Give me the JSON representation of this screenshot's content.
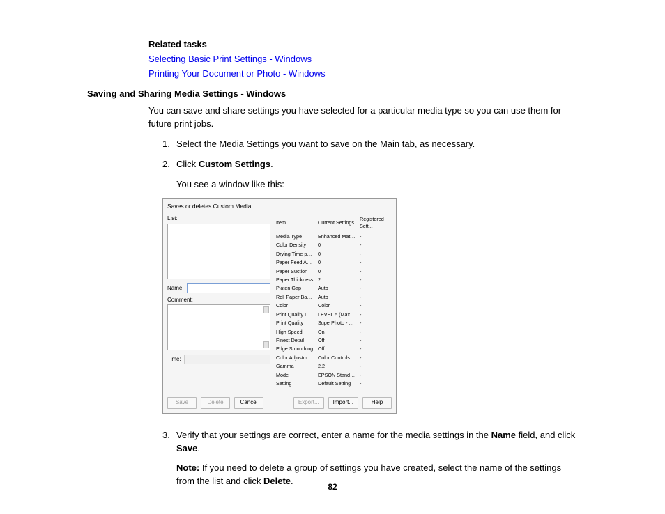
{
  "related": {
    "heading": "Related tasks",
    "links": [
      "Selecting Basic Print Settings - Windows",
      "Printing Your Document or Photo - Windows"
    ]
  },
  "section_heading": "Saving and Sharing Media Settings - Windows",
  "intro": "You can save and share settings you have selected for a particular media type so you can use them for future print jobs.",
  "steps": {
    "s1": "Select the Media Settings you want to save on the Main tab, as necessary.",
    "s2_pre": "Click ",
    "s2_bold": "Custom Settings",
    "s2_post": ".",
    "s2_line2": "You see a window like this:",
    "s3_pre": "Verify that your settings are correct, enter a name for the media settings in the ",
    "s3_bold1": "Name",
    "s3_mid": " field, and click ",
    "s3_bold2": "Save",
    "s3_post": "."
  },
  "note": {
    "label": "Note:",
    "text": " If you need to delete a group of settings you have created, select the name of the settings from the list and click ",
    "bold": "Delete",
    "post": "."
  },
  "dialog": {
    "title": "Saves or deletes Custom Media",
    "list_lbl": "List:",
    "name_lbl": "Name:",
    "comment_lbl": "Comment:",
    "time_lbl": "Time:",
    "headers": {
      "item": "Item",
      "cur": "Current Settings",
      "reg": "Registered Sett..."
    },
    "rows": [
      {
        "item": "Media Type",
        "cur": "Enhanced Matt...",
        "reg": "-"
      },
      {
        "item": "Color Density",
        "cur": "0",
        "reg": "-"
      },
      {
        "item": "Drying Time per ...",
        "cur": "0",
        "reg": "-"
      },
      {
        "item": "Paper Feed Adju...",
        "cur": "0",
        "reg": "-"
      },
      {
        "item": "Paper Suction",
        "cur": "0",
        "reg": "-"
      },
      {
        "item": "Paper Thickness",
        "cur": "2",
        "reg": "-"
      },
      {
        "item": "Platen Gap",
        "cur": "Auto",
        "reg": "-"
      },
      {
        "item": "Roll Paper Back ...",
        "cur": "Auto",
        "reg": "-"
      },
      {
        "item": "Color",
        "cur": "Color",
        "reg": "-"
      },
      {
        "item": "Print Quality Level",
        "cur": "LEVEL 5 (Max Q...",
        "reg": "-"
      },
      {
        "item": "Print Quality",
        "cur": "SuperPhoto - 2...",
        "reg": "-"
      },
      {
        "item": "High Speed",
        "cur": "On",
        "reg": "-"
      },
      {
        "item": "Finest Detail",
        "cur": "Off",
        "reg": "-"
      },
      {
        "item": "Edge Smoothing",
        "cur": "Off",
        "reg": "-"
      },
      {
        "item": "Color Adjustment",
        "cur": "Color Controls",
        "reg": "-"
      },
      {
        "item": "Gamma",
        "cur": "2.2",
        "reg": "-"
      },
      {
        "item": "Mode",
        "cur": "EPSON Standar...",
        "reg": "-"
      },
      {
        "item": "Setting",
        "cur": "Default Setting",
        "reg": "-"
      }
    ],
    "buttons": {
      "save": "Save",
      "delete": "Delete",
      "cancel": "Cancel",
      "export": "Export...",
      "import": "Import...",
      "help": "Help"
    }
  },
  "page_number": "82"
}
